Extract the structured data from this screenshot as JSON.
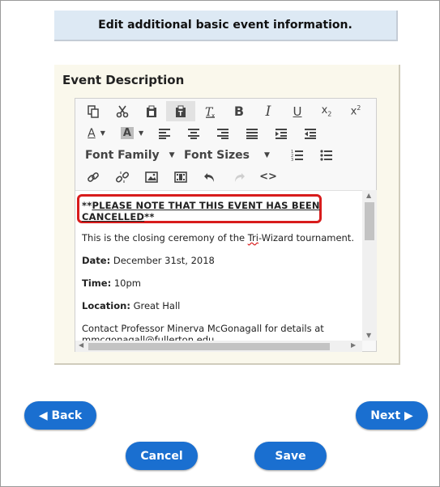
{
  "banner": {
    "text": "Edit additional basic event information."
  },
  "panel": {
    "title": "Event Description"
  },
  "toolbar": {
    "font_family_label": "Font Family",
    "font_sizes_label": "Font Sizes"
  },
  "content": {
    "note_prefix": "**",
    "note_main": "PLEASE NOTE THAT THIS EVENT HAS BEEN CANCELLED",
    "note_suffix": "**",
    "intro_before": "This is the closing ceremony of the ",
    "intro_misspelled": "Tri",
    "intro_after": "-Wizard tournament.",
    "date_label": "Date:",
    "date_value": " December 31st, 2018",
    "time_label": "Time:",
    "time_value": " 10pm",
    "location_label": "Location:",
    "location_value": " Great Hall",
    "contact": "Contact Professor Minerva McGonagall for details at mmcgonagall@fullerton.edu."
  },
  "buttons": {
    "back": "◀ Back",
    "next": "Next ▶",
    "cancel": "Cancel",
    "save": "Save"
  },
  "colors": {
    "button": "#1a6fd0",
    "highlight_border": "#d81c1c",
    "banner_bg": "#dde9f4",
    "panel_bg": "#faf8ec"
  }
}
